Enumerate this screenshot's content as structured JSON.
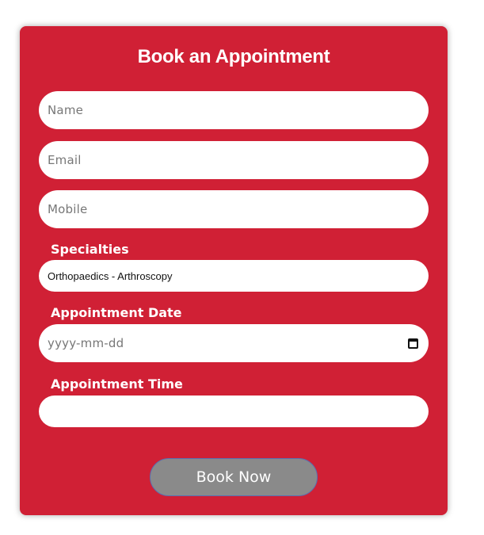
{
  "form": {
    "title": "Book an Appointment",
    "name_placeholder": "Name",
    "email_placeholder": "Email",
    "mobile_placeholder": "Mobile",
    "specialties_label": "Specialties",
    "specialty_selected": "Orthopaedics - Arthroscopy",
    "date_label": "Appointment Date",
    "date_placeholder": "yyyy-mm-dd",
    "time_label": "Appointment Time",
    "time_value": "",
    "submit_label": "Book Now"
  },
  "colors": {
    "card_background": "#d02035",
    "button_background": "#8a8a8a",
    "field_background": "#ffffff"
  },
  "icons": {
    "date_picker": "calendar-icon"
  }
}
